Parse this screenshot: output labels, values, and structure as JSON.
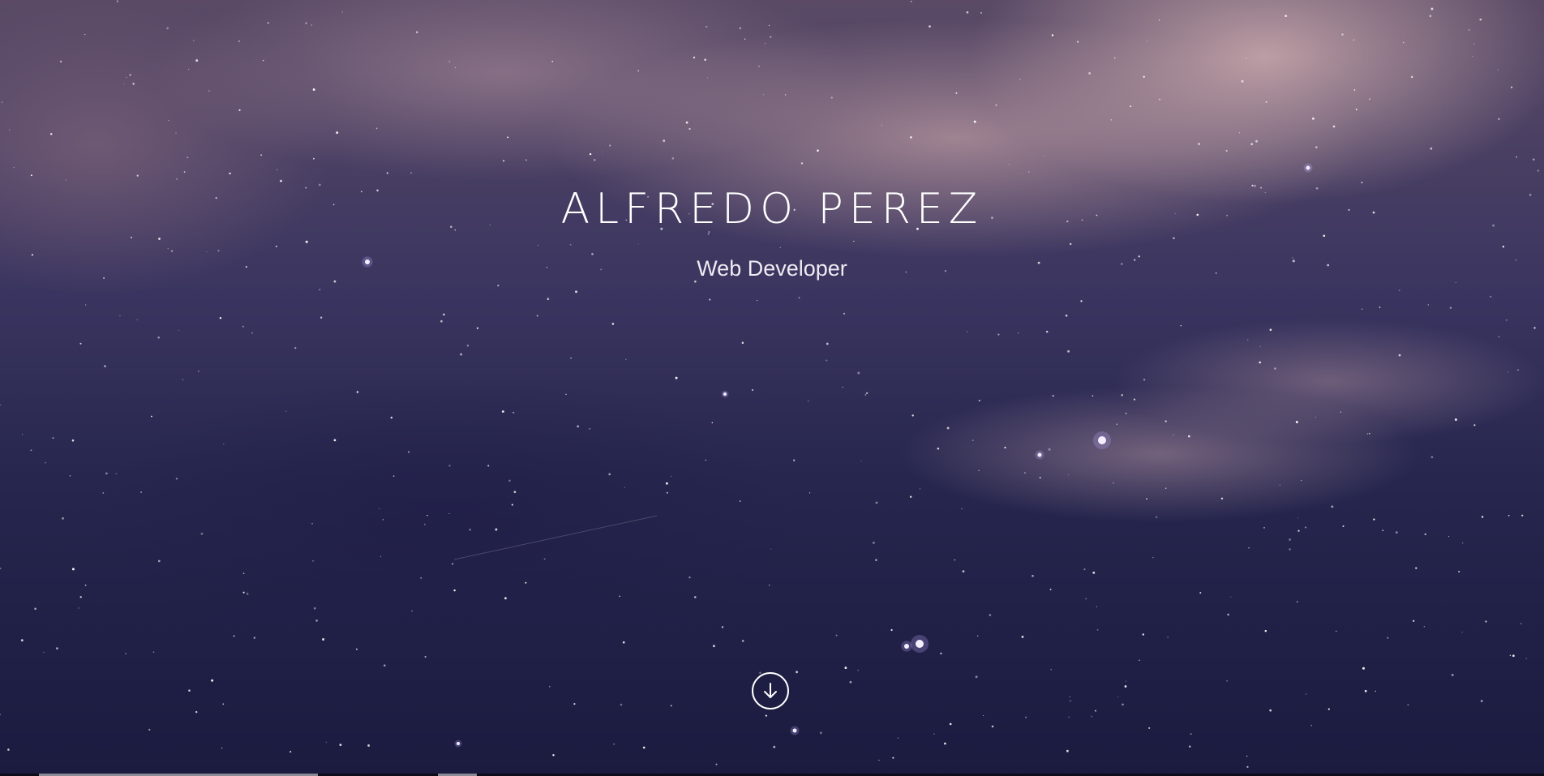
{
  "hero": {
    "title": "ALFREDO PEREZ",
    "subtitle": "Web Developer",
    "scroll_icon": "arrow-down-circle-icon"
  },
  "colors": {
    "text": "#ffffff",
    "sky_dark": "#1b1b40",
    "cloud_pink": "#c8a6a8"
  }
}
